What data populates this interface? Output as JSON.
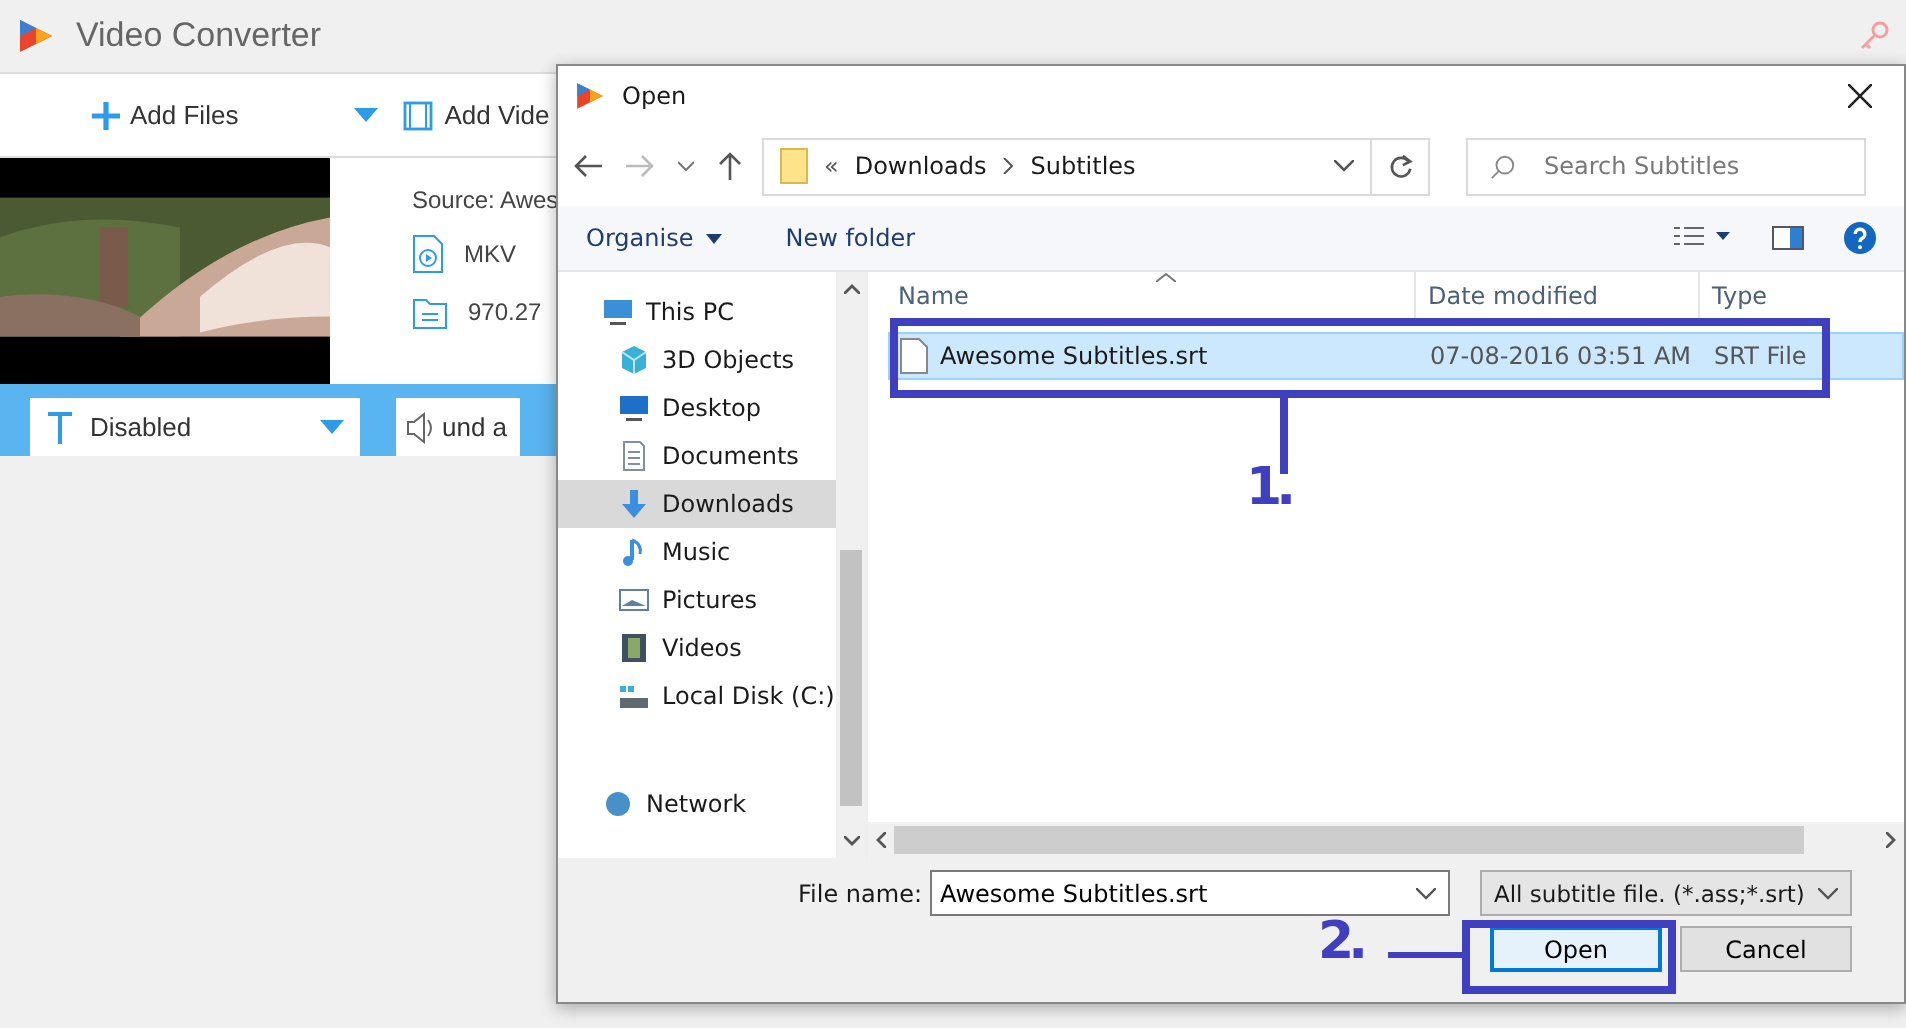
{
  "app": {
    "title": "Video Converter",
    "toolbar": [
      {
        "label": "Add Files",
        "kind": "add"
      },
      {
        "label": "Add Vide",
        "kind": "video"
      }
    ],
    "source": "Source: Awes",
    "format": "MKV",
    "size": "970.27",
    "subtitle_select": "Disabled",
    "audio_select": "und a"
  },
  "dialog": {
    "title": "Open",
    "path_prefix": "«",
    "path": [
      "Downloads",
      "Subtitles"
    ],
    "search_placeholder": "Search Subtitles",
    "commands": [
      "Organise",
      "New folder"
    ],
    "nav": [
      {
        "label": "This PC",
        "kind": "pc",
        "selected": false,
        "children": [
          {
            "label": "3D Objects",
            "kind": "objects",
            "selected": false
          },
          {
            "label": "Desktop",
            "kind": "desktop",
            "selected": false
          },
          {
            "label": "Documents",
            "kind": "documents",
            "selected": false
          },
          {
            "label": "Downloads",
            "kind": "downloads",
            "selected": true
          },
          {
            "label": "Music",
            "kind": "music",
            "selected": false
          },
          {
            "label": "Pictures",
            "kind": "pictures",
            "selected": false
          },
          {
            "label": "Videos",
            "kind": "videos",
            "selected": false
          },
          {
            "label": "Local Disk (C:)",
            "kind": "disk",
            "selected": false
          }
        ]
      },
      {
        "label": "Network",
        "kind": "network",
        "selected": false
      }
    ],
    "columns": [
      "Name",
      "Date modified",
      "Type"
    ],
    "files": [
      {
        "name": "Awesome Subtitles.srt",
        "date": "07-08-2016 03:51 AM",
        "type": "SRT File",
        "selected": true
      }
    ],
    "file_name_label": "File name:",
    "file_name": "Awesome Subtitles.srt",
    "filter": "All subtitle file. (*.ass;*.srt)",
    "buttons": [
      "Open",
      "Cancel"
    ]
  },
  "annotations": [
    "1.",
    "2."
  ]
}
